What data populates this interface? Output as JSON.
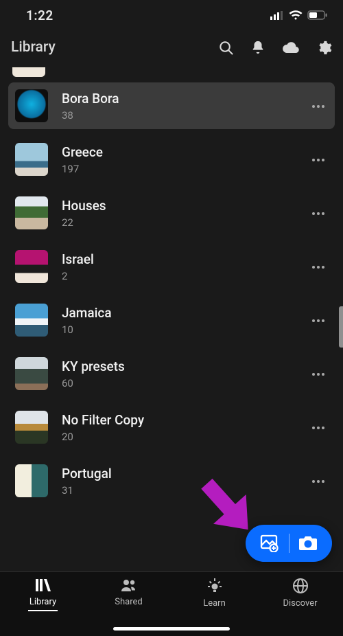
{
  "status": {
    "time": "1:22"
  },
  "header": {
    "title": "Library"
  },
  "albums": [
    {
      "name": "Bora Bora",
      "count": "38",
      "thumb_class": "th-bora",
      "selected": true
    },
    {
      "name": "Greece",
      "count": "197",
      "thumb_class": "th-greece",
      "selected": false
    },
    {
      "name": "Houses",
      "count": "22",
      "thumb_class": "th-houses",
      "selected": false
    },
    {
      "name": "Israel",
      "count": "2",
      "thumb_class": "th-israel",
      "selected": false
    },
    {
      "name": "Jamaica",
      "count": "10",
      "thumb_class": "th-jamaica",
      "selected": false
    },
    {
      "name": "KY presets",
      "count": "60",
      "thumb_class": "th-ky",
      "selected": false
    },
    {
      "name": "No Filter Copy",
      "count": "20",
      "thumb_class": "th-nofilter",
      "selected": false
    },
    {
      "name": "Portugal",
      "count": "31",
      "thumb_class": "th-portugal",
      "selected": false
    }
  ],
  "tabs": [
    {
      "label": "Library",
      "active": true
    },
    {
      "label": "Shared",
      "active": false
    },
    {
      "label": "Learn",
      "active": false
    },
    {
      "label": "Discover",
      "active": false
    }
  ],
  "annotation": {
    "arrow_color": "#b41dbf"
  },
  "accent": {
    "fab_bg": "#0a6cff"
  }
}
